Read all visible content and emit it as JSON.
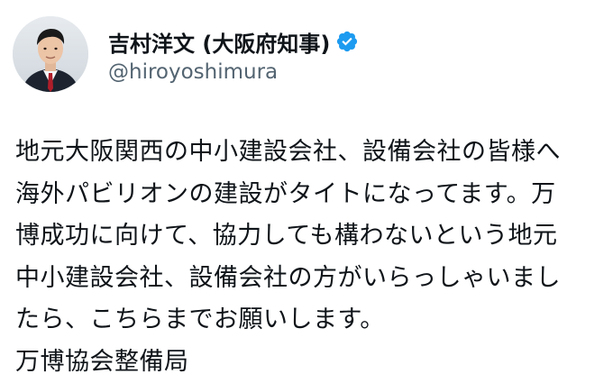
{
  "author": {
    "display_name": "吉村洋文 (大阪府知事)",
    "handle": "@hiroyoshimura",
    "verified": true,
    "avatar_icon": "profile-photo",
    "verified_icon": "verified-badge-icon",
    "verified_color": "#1d9bf0"
  },
  "tweet": {
    "lines": [
      "地元大阪関西の中小建設会社、設備会社の皆様へ",
      "海外パビリオンの建設がタイトになってます。万",
      "博成功に向けて、協力しても構わないという地元",
      "中小建設会社、設備会社の方がいらっしゃいまし",
      "たら、こちらまでお願いします。",
      "万博協会整備局"
    ]
  }
}
